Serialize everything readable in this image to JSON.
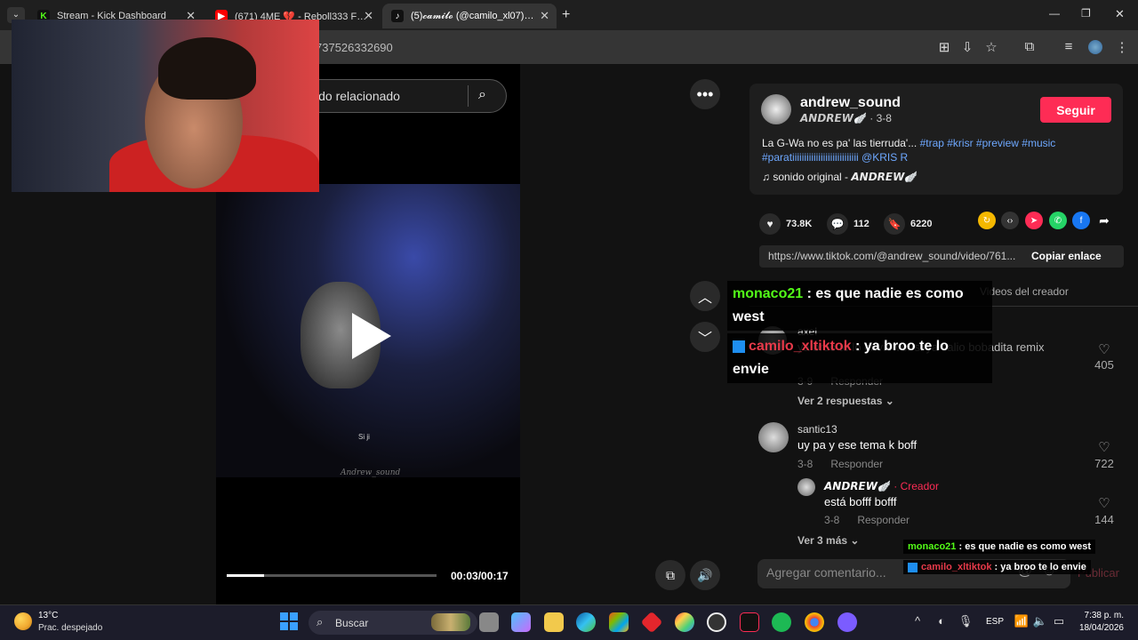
{
  "browser": {
    "tabs": [
      {
        "title": "Stream - Kick Dashboard",
        "fav": "K",
        "favColor": "#53fc18"
      },
      {
        "title": "(671) 4ME 💔 - Reboll333 Ft. Es",
        "fav": "▶",
        "favColor": "#ff0000"
      },
      {
        "title": "(5)𝓬𝓪𝓶𝓲𝓵𝓸 (@camilo_xl07) | Tik",
        "fav": "♪",
        "favColor": "#111111"
      }
    ],
    "new_tab": "+",
    "url": "737526332690",
    "icons": [
      "translate-icon",
      "install-icon",
      "star-icon",
      "extensions-icon",
      "media-icon",
      "profile-icon",
      "menu-icon"
    ]
  },
  "video": {
    "search_text": "ido relacionado",
    "caption": "Si ji",
    "watermark": "Andrew_sound",
    "time": "00:03/00:17",
    "progress": 0.18
  },
  "post": {
    "author": "andrew_sound",
    "author_sub": "𝘼𝙉𝘿𝙍𝙀𝙒🪽 · 3-8",
    "follow": "Seguir",
    "desc_text": "La G-Wa no es pa' las tierruda'... ",
    "desc_tags": "#trap #krisr #preview #music #paratiiiiiiiiiiiiiiiiiiiiiiiiiiii @KRIS R",
    "sound": "♫  sonido original - 𝘼𝙉𝘿𝙍𝙀𝙒🪽",
    "likes": "73.8K",
    "comments": "112",
    "saves": "6220",
    "link": "https://www.tiktok.com/@andrew_sound/video/761...",
    "copy_link": "Copiar enlace",
    "tab_creator": "Videos del creador"
  },
  "comments": [
    {
      "name": "axel",
      "text": "ya broo te lo envie ver si ya salio bobadita remix",
      "date": "3-9",
      "reply": "Responder",
      "likes": "405",
      "more": "Ver 2 respuestas ⌄"
    },
    {
      "name": "santic13",
      "text": "uy pa y ese tema k boff",
      "date": "3-8",
      "reply": "Responder",
      "likes": "722"
    },
    {
      "name": "𝘼𝙉𝘿𝙍𝙀𝙒🪽",
      "creator": "· Creador",
      "text": "está bofff bofff",
      "date": "3-8",
      "reply": "Responder",
      "likes": "144",
      "more": "Ver 3 más ⌄"
    }
  ],
  "input_placeholder": "Agregar comentario...",
  "post_btn": "Publicar",
  "chat": {
    "big": [
      {
        "user": "monaco21",
        "text": " : es que nadie es como west"
      },
      {
        "user": "camilo_xltiktok",
        "text": " : ya broo te lo envie"
      }
    ],
    "small": [
      {
        "user": "monaco21",
        "text": " : es que nadie es como west"
      },
      {
        "user": "camilo_xltiktok",
        "text": " : ya broo te lo envie"
      }
    ]
  },
  "taskbar": {
    "temp": "13°C",
    "weather": "Prac. despejado",
    "search": "Buscar",
    "lang": "ESP",
    "time": "7:38 p. m.",
    "date": "18/04/2026"
  }
}
